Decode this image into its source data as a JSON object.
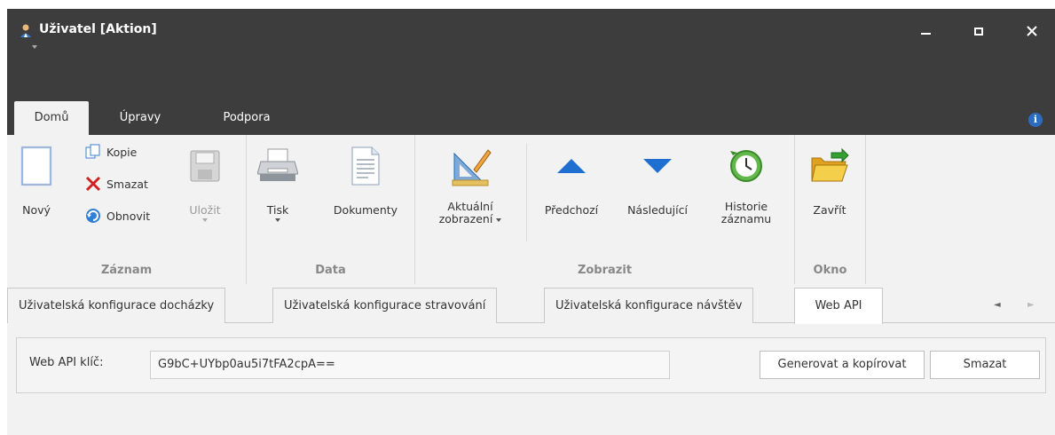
{
  "window": {
    "title": "Uživatel [Aktion]",
    "controls": [
      "minimize",
      "maximize",
      "close"
    ]
  },
  "ribbon_tabs": [
    {
      "label": "Domů",
      "active": true
    },
    {
      "label": "Úpravy",
      "active": false
    },
    {
      "label": "Podpora",
      "active": false
    }
  ],
  "ribbon": {
    "zaznam": {
      "label": "Záznam",
      "novy": "Nový",
      "kopie": "Kopie",
      "smazat": "Smazat",
      "obnovit": "Obnovit",
      "ulozit": "Uložit"
    },
    "data": {
      "label": "Data",
      "tisk": "Tisk",
      "dokumenty": "Dokumenty"
    },
    "zobrazit": {
      "label": "Zobrazit",
      "aktualni_1": "Aktuální",
      "aktualni_2": "zobrazení",
      "predchozi": "Předchozí",
      "nasledujici": "Následující",
      "historie_1": "Historie",
      "historie_2": "záznamu"
    },
    "okno": {
      "label": "Okno",
      "zavrit": "Zavřít"
    }
  },
  "doc_tabs": [
    {
      "label": "Uživatelská konfigurace docházky",
      "active": false
    },
    {
      "label": "Uživatelská konfigurace stravování",
      "active": false
    },
    {
      "label": "Uživatelská konfigurace návštěv",
      "active": false
    },
    {
      "label": "Web API",
      "active": true
    }
  ],
  "web_api": {
    "key_label": "Web API klíč:",
    "key_value": "G9bC+UYbp0au5i7tFA2cpA==",
    "generate_button": "Generovat a kopírovat",
    "delete_button": "Smazat"
  },
  "colors": {
    "titlebar": "#3d3d3d",
    "ribbon_bg": "#f2f2f2",
    "accent_blue": "#1f6fd1"
  }
}
